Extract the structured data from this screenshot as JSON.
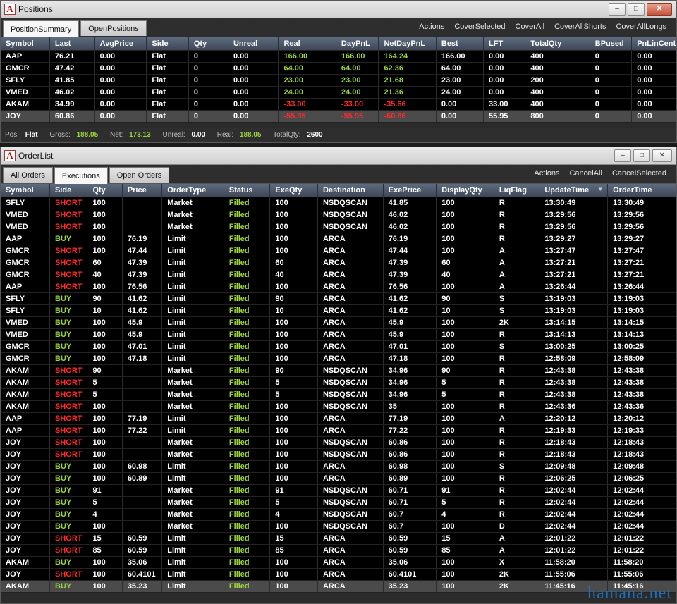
{
  "positions_window": {
    "title": "Positions",
    "tabs": [
      "PositionSummary",
      "OpenPositions"
    ],
    "active_tab": 0,
    "actions": [
      "Actions",
      "CoverSelected",
      "CoverAll",
      "CoverAllShorts",
      "CoverAllLongs"
    ],
    "columns": [
      "Symbol",
      "Last",
      "AvgPrice",
      "Side",
      "Qty",
      "Unreal",
      "Real",
      "DayPnL",
      "NetDayPnL",
      "Best",
      "LFT",
      "TotalQty",
      "BPused",
      "PnLinCents"
    ],
    "rows": [
      [
        "AAP",
        "76.21",
        "0.00",
        "Flat",
        "0",
        "0.00",
        "166.00",
        "166.00",
        "164.24",
        "166.00",
        "0.00",
        "400",
        "0",
        "0.00"
      ],
      [
        "GMCR",
        "47.42",
        "0.00",
        "Flat",
        "0",
        "0.00",
        "64.00",
        "64.00",
        "62.36",
        "64.00",
        "0.00",
        "400",
        "0",
        "0.00"
      ],
      [
        "SFLY",
        "41.85",
        "0.00",
        "Flat",
        "0",
        "0.00",
        "23.00",
        "23.00",
        "21.68",
        "23.00",
        "0.00",
        "200",
        "0",
        "0.00"
      ],
      [
        "VMED",
        "46.02",
        "0.00",
        "Flat",
        "0",
        "0.00",
        "24.00",
        "24.00",
        "21.36",
        "24.00",
        "0.00",
        "400",
        "0",
        "0.00"
      ],
      [
        "AKAM",
        "34.99",
        "0.00",
        "Flat",
        "0",
        "0.00",
        "-33.00",
        "-33.00",
        "-35.66",
        "0.00",
        "33.00",
        "400",
        "0",
        "0.00"
      ],
      [
        "JOY",
        "60.86",
        "0.00",
        "Flat",
        "0",
        "0.00",
        "-55.95",
        "-55.95",
        "-60.86",
        "0.00",
        "55.95",
        "800",
        "0",
        "0.00"
      ]
    ],
    "selected_row": 5,
    "status": {
      "pos_label": "Pos:",
      "pos_value": "Flat",
      "gross_label": "Gross:",
      "gross_value": "188.05",
      "net_label": "Net:",
      "net_value": "173.13",
      "unreal_label": "Unreal:",
      "unreal_value": "0.00",
      "real_label": "Real:",
      "real_value": "188.05",
      "totalqty_label": "TotalQty:",
      "totalqty_value": "2600"
    }
  },
  "orders_window": {
    "title": "OrderList",
    "tabs": [
      "All Orders",
      "Executions",
      "Open Orders"
    ],
    "active_tab": 1,
    "actions": [
      "Actions",
      "CancelAll",
      "CancelSelected"
    ],
    "columns": [
      "Symbol",
      "Side",
      "Qty",
      "Price",
      "OrderType",
      "Status",
      "ExeQty",
      "Destination",
      "ExePrice",
      "DisplayQty",
      "LiqFlag",
      "UpdateTime",
      "OrderTime"
    ],
    "sort_column": "UpdateTime",
    "sort_indicator": "▼",
    "rows": [
      [
        "SFLY",
        "SHORT",
        "100",
        "",
        "Market",
        "Filled",
        "100",
        "NSDQSCAN",
        "41.85",
        "100",
        "R",
        "13:30:49",
        "13:30:49"
      ],
      [
        "VMED",
        "SHORT",
        "100",
        "",
        "Market",
        "Filled",
        "100",
        "NSDQSCAN",
        "46.02",
        "100",
        "R",
        "13:29:56",
        "13:29:56"
      ],
      [
        "VMED",
        "SHORT",
        "100",
        "",
        "Market",
        "Filled",
        "100",
        "NSDQSCAN",
        "46.02",
        "100",
        "R",
        "13:29:56",
        "13:29:56"
      ],
      [
        "AAP",
        "BUY",
        "100",
        "76.19",
        "Limit",
        "Filled",
        "100",
        "ARCA",
        "76.19",
        "100",
        "R",
        "13:29:27",
        "13:29:27"
      ],
      [
        "GMCR",
        "SHORT",
        "100",
        "47.44",
        "Limit",
        "Filled",
        "100",
        "ARCA",
        "47.44",
        "100",
        "A",
        "13:27:47",
        "13:27:47"
      ],
      [
        "GMCR",
        "SHORT",
        "60",
        "47.39",
        "Limit",
        "Filled",
        "60",
        "ARCA",
        "47.39",
        "60",
        "A",
        "13:27:21",
        "13:27:21"
      ],
      [
        "GMCR",
        "SHORT",
        "40",
        "47.39",
        "Limit",
        "Filled",
        "40",
        "ARCA",
        "47.39",
        "40",
        "A",
        "13:27:21",
        "13:27:21"
      ],
      [
        "AAP",
        "SHORT",
        "100",
        "76.56",
        "Limit",
        "Filled",
        "100",
        "ARCA",
        "76.56",
        "100",
        "A",
        "13:26:44",
        "13:26:44"
      ],
      [
        "SFLY",
        "BUY",
        "90",
        "41.62",
        "Limit",
        "Filled",
        "90",
        "ARCA",
        "41.62",
        "90",
        "S",
        "13:19:03",
        "13:19:03"
      ],
      [
        "SFLY",
        "BUY",
        "10",
        "41.62",
        "Limit",
        "Filled",
        "10",
        "ARCA",
        "41.62",
        "10",
        "S",
        "13:19:03",
        "13:19:03"
      ],
      [
        "VMED",
        "BUY",
        "100",
        "45.9",
        "Limit",
        "Filled",
        "100",
        "ARCA",
        "45.9",
        "100",
        "2K",
        "13:14:15",
        "13:14:15"
      ],
      [
        "VMED",
        "BUY",
        "100",
        "45.9",
        "Limit",
        "Filled",
        "100",
        "ARCA",
        "45.9",
        "100",
        "R",
        "13:14:13",
        "13:14:13"
      ],
      [
        "GMCR",
        "BUY",
        "100",
        "47.01",
        "Limit",
        "Filled",
        "100",
        "ARCA",
        "47.01",
        "100",
        "S",
        "13:00:25",
        "13:00:25"
      ],
      [
        "GMCR",
        "BUY",
        "100",
        "47.18",
        "Limit",
        "Filled",
        "100",
        "ARCA",
        "47.18",
        "100",
        "R",
        "12:58:09",
        "12:58:09"
      ],
      [
        "AKAM",
        "SHORT",
        "90",
        "",
        "Market",
        "Filled",
        "90",
        "NSDQSCAN",
        "34.96",
        "90",
        "R",
        "12:43:38",
        "12:43:38"
      ],
      [
        "AKAM",
        "SHORT",
        "5",
        "",
        "Market",
        "Filled",
        "5",
        "NSDQSCAN",
        "34.96",
        "5",
        "R",
        "12:43:38",
        "12:43:38"
      ],
      [
        "AKAM",
        "SHORT",
        "5",
        "",
        "Market",
        "Filled",
        "5",
        "NSDQSCAN",
        "34.96",
        "5",
        "R",
        "12:43:38",
        "12:43:38"
      ],
      [
        "AKAM",
        "SHORT",
        "100",
        "",
        "Market",
        "Filled",
        "100",
        "NSDQSCAN",
        "35",
        "100",
        "R",
        "12:43:36",
        "12:43:36"
      ],
      [
        "AAP",
        "SHORT",
        "100",
        "77.19",
        "Limit",
        "Filled",
        "100",
        "ARCA",
        "77.19",
        "100",
        "A",
        "12:20:12",
        "12:20:12"
      ],
      [
        "AAP",
        "SHORT",
        "100",
        "77.22",
        "Limit",
        "Filled",
        "100",
        "ARCA",
        "77.22",
        "100",
        "R",
        "12:19:33",
        "12:19:33"
      ],
      [
        "JOY",
        "SHORT",
        "100",
        "",
        "Market",
        "Filled",
        "100",
        "NSDQSCAN",
        "60.86",
        "100",
        "R",
        "12:18:43",
        "12:18:43"
      ],
      [
        "JOY",
        "SHORT",
        "100",
        "",
        "Market",
        "Filled",
        "100",
        "NSDQSCAN",
        "60.86",
        "100",
        "R",
        "12:18:43",
        "12:18:43"
      ],
      [
        "JOY",
        "BUY",
        "100",
        "60.98",
        "Limit",
        "Filled",
        "100",
        "ARCA",
        "60.98",
        "100",
        "S",
        "12:09:48",
        "12:09:48"
      ],
      [
        "JOY",
        "BUY",
        "100",
        "60.89",
        "Limit",
        "Filled",
        "100",
        "ARCA",
        "60.89",
        "100",
        "R",
        "12:06:25",
        "12:06:25"
      ],
      [
        "JOY",
        "BUY",
        "91",
        "",
        "Market",
        "Filled",
        "91",
        "NSDQSCAN",
        "60.71",
        "91",
        "R",
        "12:02:44",
        "12:02:44"
      ],
      [
        "JOY",
        "BUY",
        "5",
        "",
        "Market",
        "Filled",
        "5",
        "NSDQSCAN",
        "60.71",
        "5",
        "R",
        "12:02:44",
        "12:02:44"
      ],
      [
        "JOY",
        "BUY",
        "4",
        "",
        "Market",
        "Filled",
        "4",
        "NSDQSCAN",
        "60.7",
        "4",
        "R",
        "12:02:44",
        "12:02:44"
      ],
      [
        "JOY",
        "BUY",
        "100",
        "",
        "Market",
        "Filled",
        "100",
        "NSDQSCAN",
        "60.7",
        "100",
        "D",
        "12:02:44",
        "12:02:44"
      ],
      [
        "JOY",
        "SHORT",
        "15",
        "60.59",
        "Limit",
        "Filled",
        "15",
        "ARCA",
        "60.59",
        "15",
        "A",
        "12:01:22",
        "12:01:22"
      ],
      [
        "JOY",
        "SHORT",
        "85",
        "60.59",
        "Limit",
        "Filled",
        "85",
        "ARCA",
        "60.59",
        "85",
        "A",
        "12:01:22",
        "12:01:22"
      ],
      [
        "AKAM",
        "BUY",
        "100",
        "35.06",
        "Limit",
        "Filled",
        "100",
        "ARCA",
        "35.06",
        "100",
        "X",
        "11:58:20",
        "11:58:20"
      ],
      [
        "JOY",
        "SHORT",
        "100",
        "60.4101",
        "Limit",
        "Filled",
        "100",
        "ARCA",
        "60.4101",
        "100",
        "2K",
        "11:55:06",
        "11:55:06"
      ],
      [
        "AKAM",
        "BUY",
        "100",
        "35.23",
        "Limit",
        "Filled",
        "100",
        "ARCA",
        "35.23",
        "100",
        "2K",
        "11:45:16",
        "11:45:16"
      ]
    ],
    "selected_row": 32
  },
  "colors": {
    "positive": "#9dd63c",
    "negative": "#ff2a2a",
    "header_bg": "#4e5a6b",
    "row_bg": "#000000",
    "selected_row_bg": "#4b4b4b"
  },
  "window_controls": {
    "minimize_icon": "minimize-icon",
    "maximize_icon": "maximize-icon",
    "close_icon": "close-icon"
  },
  "watermark": "hamana.net"
}
